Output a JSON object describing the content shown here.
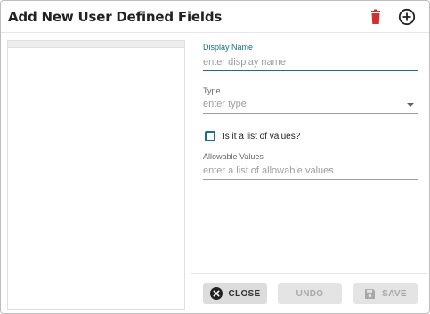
{
  "dialog": {
    "title": "Add New User Defined Fields",
    "delete_icon": "trash-icon",
    "add_icon": "plus-circle-icon"
  },
  "form": {
    "display_name": {
      "label": "Display Name",
      "placeholder": "enter display name",
      "value": ""
    },
    "type": {
      "label": "Type",
      "placeholder": "enter type"
    },
    "list_checkbox": {
      "label": "Is it a list of values?",
      "checked": false
    },
    "allowable_values": {
      "label": "Allowable Values",
      "placeholder": "enter a list of allowable values",
      "value": ""
    }
  },
  "footer": {
    "close_label": "CLOSE",
    "undo_label": "UNDO",
    "save_label": "SAVE"
  },
  "colors": {
    "accent": "#1b6f86",
    "delete": "#d32f2f"
  }
}
